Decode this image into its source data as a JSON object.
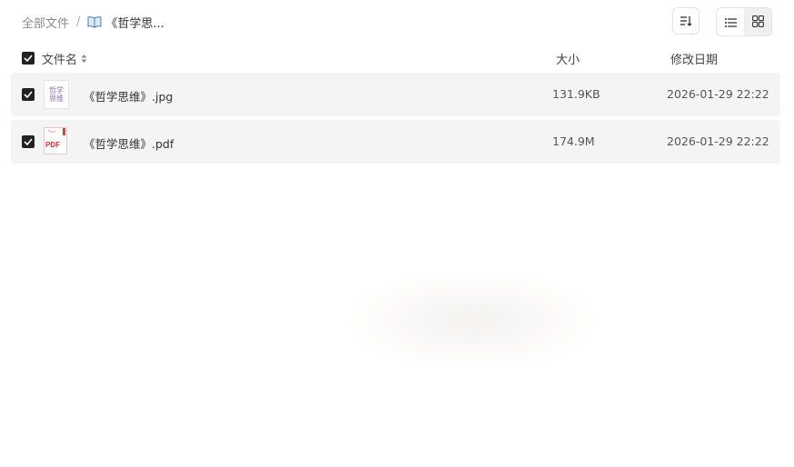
{
  "breadcrumb": {
    "root": "全部文件",
    "separator": "/",
    "current": "《哲学思..."
  },
  "toolbar": {
    "sort_icon": "sort-icon",
    "view_list_icon": "list-view-icon",
    "view_grid_icon": "grid-view-icon",
    "active_view": "list"
  },
  "header": {
    "name": "文件名",
    "size": "大小",
    "date": "修改日期"
  },
  "files": [
    {
      "name": "《哲学思维》.jpg",
      "size": "131.9KB",
      "date": "2026-01-29 22:22",
      "thumb_text": [
        "哲学",
        "思维"
      ],
      "checked": true
    },
    {
      "name": "《哲学思维》.pdf",
      "size": "174.9M",
      "date": "2026-01-29 22:22",
      "thumb_text": "PDF",
      "checked": true
    }
  ],
  "colors": {
    "checkbox": "#222222",
    "row_bg": "#f4f4f4",
    "pdf_red": "#e03a3a"
  }
}
